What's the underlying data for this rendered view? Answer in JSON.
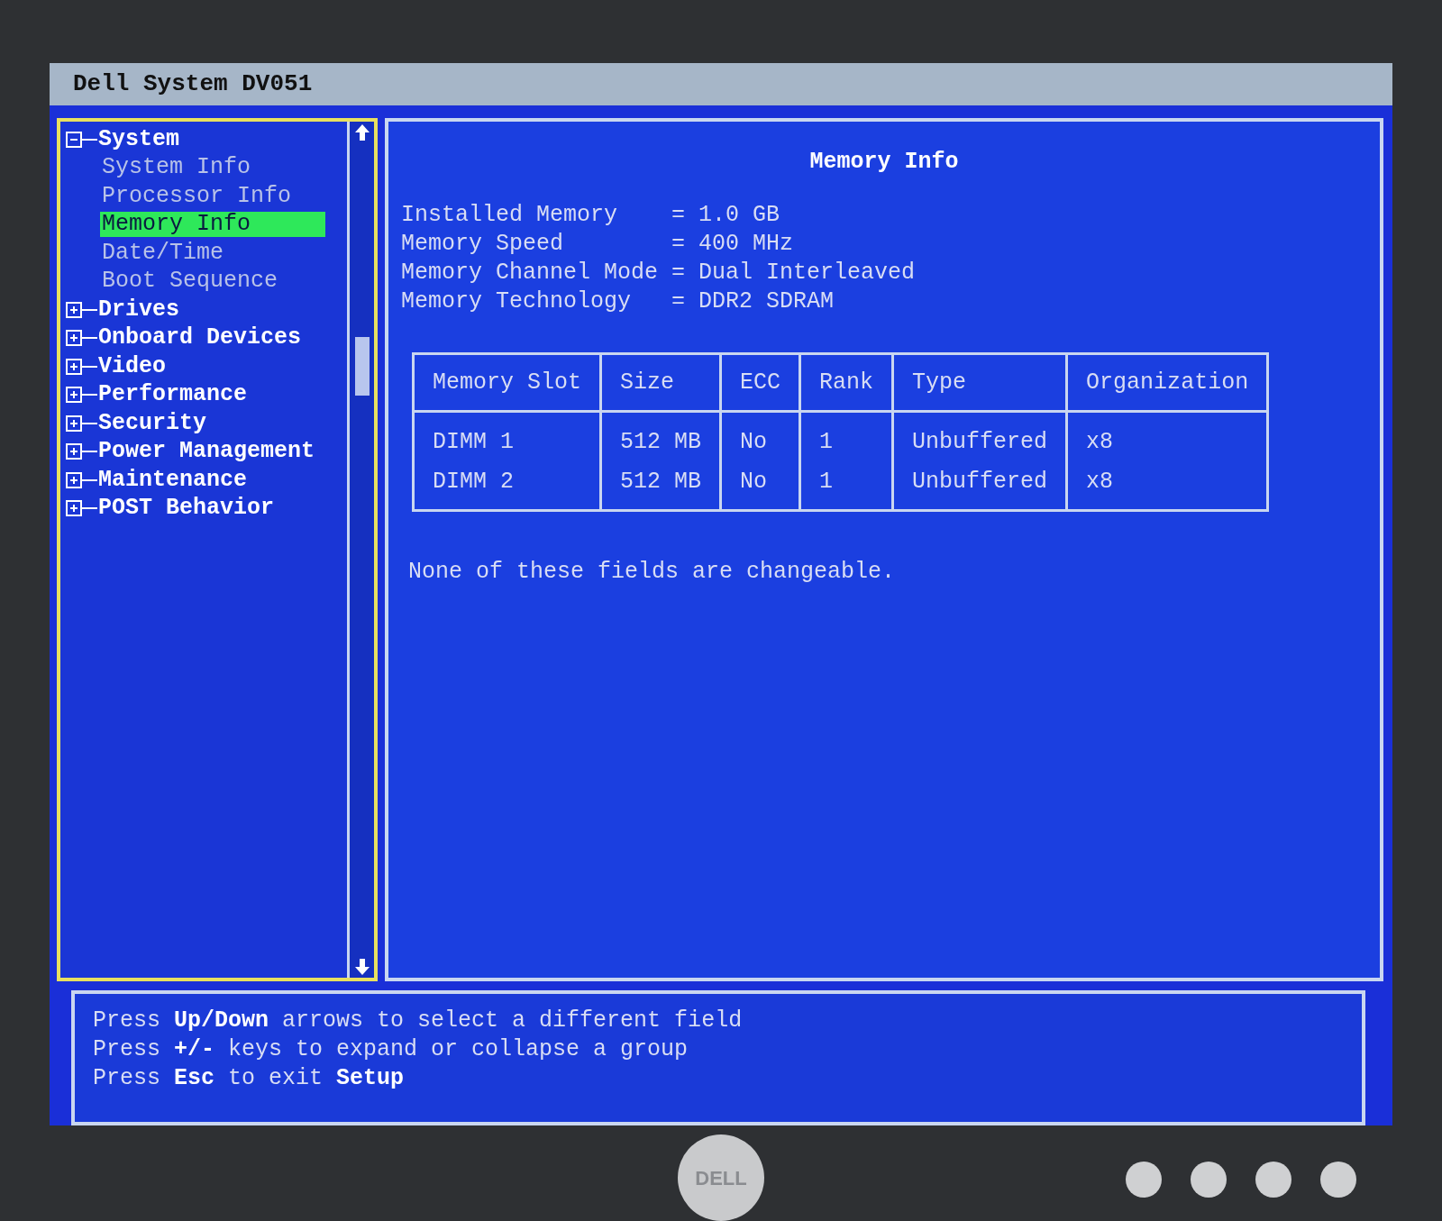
{
  "window": {
    "title": "Dell System DV051"
  },
  "tree": [
    {
      "label": "System",
      "expanded": true,
      "children": [
        {
          "label": "System Info",
          "selected": false
        },
        {
          "label": "Processor Info",
          "selected": false
        },
        {
          "label": "Memory Info",
          "selected": true
        },
        {
          "label": "Date/Time",
          "selected": false
        },
        {
          "label": "Boot Sequence",
          "selected": false
        }
      ]
    },
    {
      "label": "Drives",
      "expanded": false
    },
    {
      "label": "Onboard Devices",
      "expanded": false
    },
    {
      "label": "Video",
      "expanded": false
    },
    {
      "label": "Performance",
      "expanded": false
    },
    {
      "label": "Security",
      "expanded": false
    },
    {
      "label": "Power Management",
      "expanded": false
    },
    {
      "label": "Maintenance",
      "expanded": false
    },
    {
      "label": "POST Behavior",
      "expanded": false
    }
  ],
  "content": {
    "title": "Memory Info",
    "fields": [
      {
        "label": "Installed Memory",
        "value": "= 1.0 GB"
      },
      {
        "label": "Memory Speed",
        "value": "= 400 MHz"
      },
      {
        "label": "Memory Channel Mode",
        "value": "= Dual Interleaved"
      },
      {
        "label": "Memory Technology",
        "value": "= DDR2 SDRAM"
      }
    ],
    "table": {
      "columns": [
        "Memory Slot",
        "Size",
        "ECC",
        "Rank",
        "Type",
        "Organization"
      ],
      "rows": [
        [
          "DIMM 1",
          "512 MB",
          "No",
          "1",
          "Unbuffered",
          "x8"
        ],
        [
          "DIMM 2",
          "512 MB",
          "No",
          "1",
          "Unbuffered",
          "x8"
        ]
      ]
    },
    "note": "None of these fields are changeable."
  },
  "help": [
    "Press **Up/Down** arrows to select a different field",
    "Press **+/-** keys to expand or collapse a group",
    "Press **Esc** to exit **Setup**"
  ],
  "monitor": {
    "logo": "DELL"
  }
}
